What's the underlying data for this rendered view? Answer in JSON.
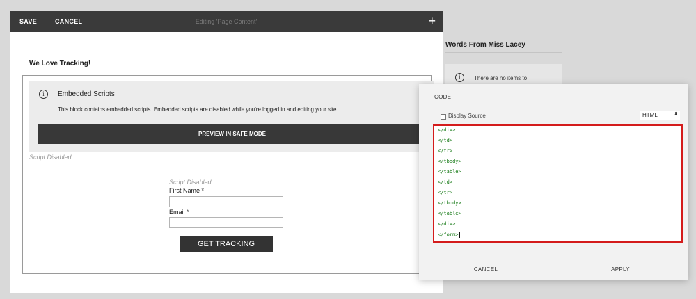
{
  "toolbar": {
    "save_label": "SAVE",
    "cancel_label": "CANCEL",
    "title": "Editing 'Page Content'",
    "add_label": "+"
  },
  "content": {
    "heading": "We Love Tracking!",
    "embed": {
      "info_icon": "i",
      "title": "Embedded Scripts",
      "description": "This block contains embedded scripts. Embedded scripts are disabled while you're logged in and editing your site.",
      "preview_label": "PREVIEW IN SAFE MODE"
    },
    "script_disabled_1": "Script Disabled",
    "form": {
      "script_disabled": "Script Disabled",
      "first_name_label": "First Name *",
      "email_label": "Email *",
      "submit_label": "GET TRACKING"
    }
  },
  "sidebar": {
    "title": "Words From Miss Lacey",
    "info_icon": "i",
    "empty_text": "There are no items to"
  },
  "code_dialog": {
    "title": "CODE",
    "display_source_label": "Display Source",
    "mode_value": "HTML",
    "mode_arrow": "⬍",
    "lines": [
      "</div>",
      "</td>",
      "</tr>",
      "</tbody>",
      "</table>",
      "</td>",
      "</tr>",
      "</tbody>",
      "</table>",
      "</div>",
      "</form>"
    ],
    "cancel_label": "CANCEL",
    "apply_label": "APPLY"
  },
  "colors": {
    "topbar": "#3a3a3a",
    "highlight_border": "#d41c1c",
    "code_text": "#117711"
  }
}
